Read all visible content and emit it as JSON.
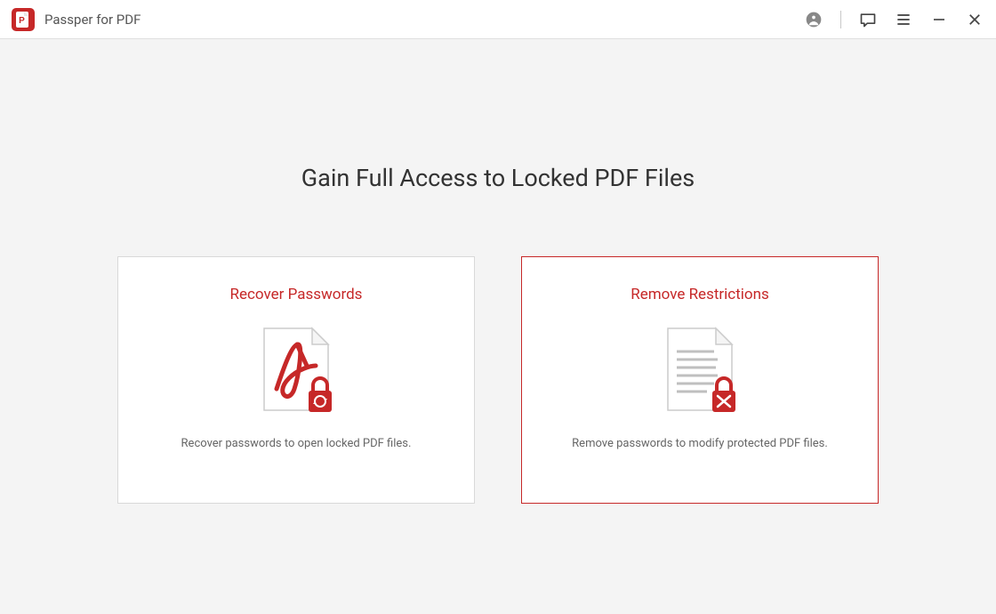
{
  "titlebar": {
    "app_title": "Passper for PDF"
  },
  "main": {
    "headline": "Gain Full Access to Locked PDF Files",
    "cards": [
      {
        "title": "Recover Passwords",
        "description": "Recover passwords to open locked PDF files.",
        "icon": "pdf-lock-sync-icon",
        "selected": false
      },
      {
        "title": "Remove Restrictions",
        "description": "Remove passwords to modify protected PDF files.",
        "icon": "doc-lock-remove-icon",
        "selected": true
      }
    ]
  },
  "colors": {
    "accent": "#c62828",
    "text_primary": "#333333",
    "text_secondary": "#666666"
  }
}
